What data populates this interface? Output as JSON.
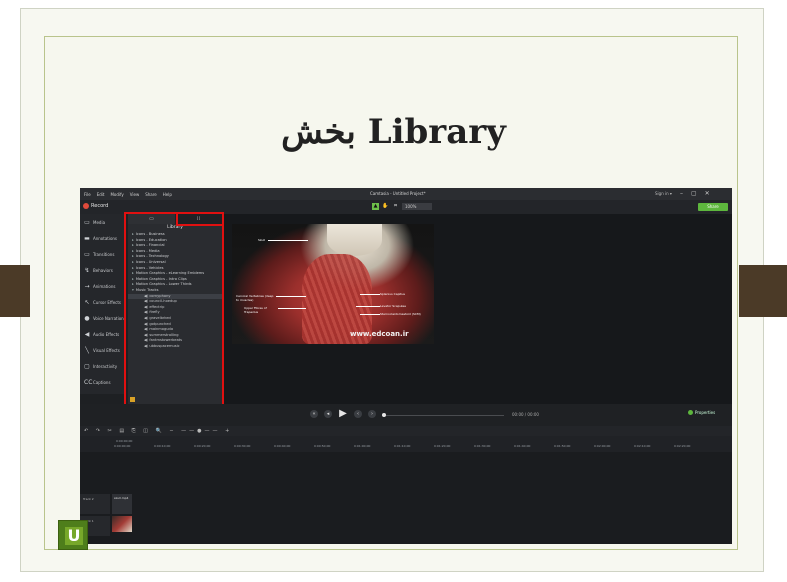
{
  "slide": {
    "title": "بخش Library"
  },
  "app": {
    "menu": [
      "File",
      "Edit",
      "Modify",
      "View",
      "Share",
      "Help"
    ],
    "window_title": "Camtasia - Untitled Project*",
    "signin": "Sign in ▾",
    "record_label": "Record",
    "zoom": "100%",
    "share_label": "Share",
    "tools": [
      {
        "label": "Media",
        "icon": "media-icon"
      },
      {
        "label": "Annotations",
        "icon": "annotations-icon"
      },
      {
        "label": "Transitions",
        "icon": "transitions-icon"
      },
      {
        "label": "Behaviors",
        "icon": "behaviors-icon"
      },
      {
        "label": "Animations",
        "icon": "animations-icon"
      },
      {
        "label": "Cursor Effects",
        "icon": "cursor-icon"
      },
      {
        "label": "Voice Narration",
        "icon": "mic-icon"
      },
      {
        "label": "Audio Effects",
        "icon": "audio-icon"
      },
      {
        "label": "Visual Effects",
        "icon": "visual-icon"
      },
      {
        "label": "Interactivity",
        "icon": "interactivity-icon"
      },
      {
        "label": "Captions",
        "icon": "captions-icon"
      }
    ],
    "library": {
      "heading": "Library",
      "items": [
        "Icons - Business",
        "Icons - Education",
        "Icons - Financial",
        "Icons - Media",
        "Icons - Technology",
        "Icons - Universal",
        "Icons - Vehicles",
        "Motion Graphics - eLearning Emblems",
        "Motion Graphics - Intro Clips",
        "Motion Graphics - Lower Thirds",
        "Music Tracks"
      ],
      "sub_items": [
        "cornyphony",
        "council-hoedup",
        "effectrip",
        "firefly",
        "gravelbrked",
        "gotpunched",
        "mainmoguda",
        "summerstrolling",
        "fantmstowerbeats",
        "ubbuspacemusic"
      ]
    },
    "video": {
      "labels": [
        "Skull",
        "Splenius Capitus",
        "Cervical Vertebrae (deep to muscles)",
        "Levator Scapulae",
        "Upper Fibres of Trapezius",
        "Sternocleidomastoid (SCM)"
      ],
      "watermark": "www.edcoan.ir"
    },
    "playback": {
      "timecode": "00:00 / 00:00",
      "properties_label": "Properties"
    },
    "timeline": {
      "start_time": "0:00:00;00",
      "ticks": [
        "0:00:00;00",
        "0:00:10;00",
        "0:00:20;00",
        "0:00:30;00",
        "0:00:40;00",
        "0:00:50;00",
        "0:01:00;00",
        "0:01:10;00",
        "0:01:20;00",
        "0:01:30;00",
        "0:01:40;00",
        "0:01:50;00",
        "0:02:00;00",
        "0:02:10;00",
        "0:02:20;00"
      ],
      "tracks": [
        "Track 2",
        "Track 1"
      ],
      "clip_label": "skull.mp4"
    }
  },
  "colors": {
    "highlight": "#e01010",
    "accent_green": "#5db63d",
    "frame_bar": "#4b3a27"
  }
}
